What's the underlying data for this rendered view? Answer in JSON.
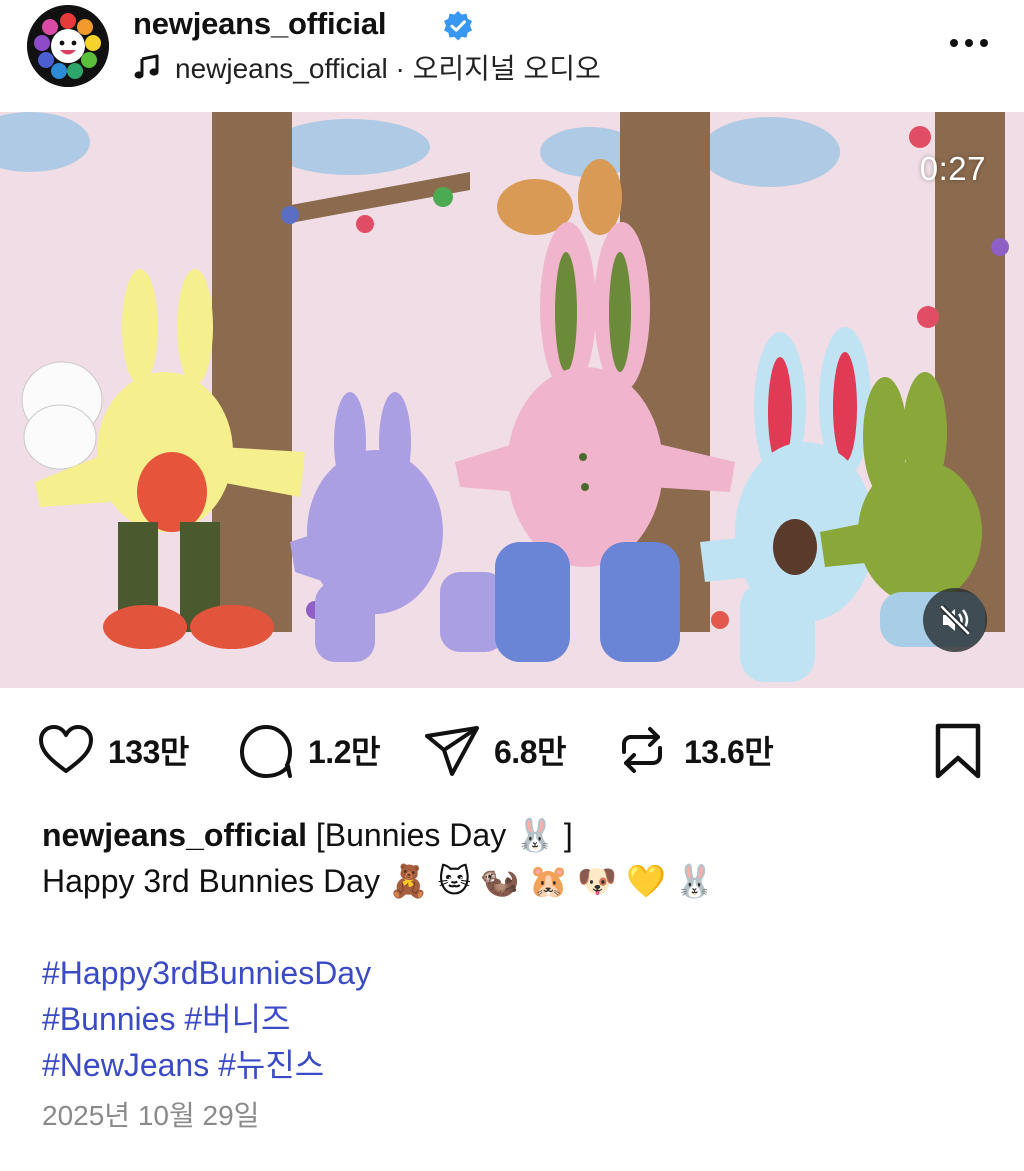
{
  "header": {
    "username": "newjeans_official",
    "audio_text": "newjeans_official · 오리지널 오디오",
    "icons": [
      "avatar",
      "verified-badge-icon",
      "music-note-icon",
      "more-options-icon"
    ]
  },
  "media": {
    "timer": "0:27",
    "icons": [
      "mute-icon"
    ]
  },
  "actions": {
    "likes": "133만",
    "comments": "1.2만",
    "shares": "6.8만",
    "reposts": "13.6만",
    "icons": [
      "heart-icon",
      "comment-icon",
      "share-icon",
      "repost-icon",
      "bookmark-icon"
    ]
  },
  "caption": {
    "username": "newjeans_official",
    "title": "[Bunnies Day 🐰 ]",
    "line2": "Happy 3rd Bunnies Day 🧸 🐱 🦦 🐹 🐶 💛 🐰",
    "hashtag1": "#Happy3rdBunniesDay",
    "hashtag2": "#Bunnies",
    "hashtag3": "#버니즈",
    "hashtag4": "#NewJeans",
    "hashtag5": "#뉴진스"
  },
  "date": "2025년 10월 29일",
  "colors": {
    "hashtag": "#3b4bc6",
    "verified": "#3897f0",
    "date": "#8a8a8a"
  }
}
